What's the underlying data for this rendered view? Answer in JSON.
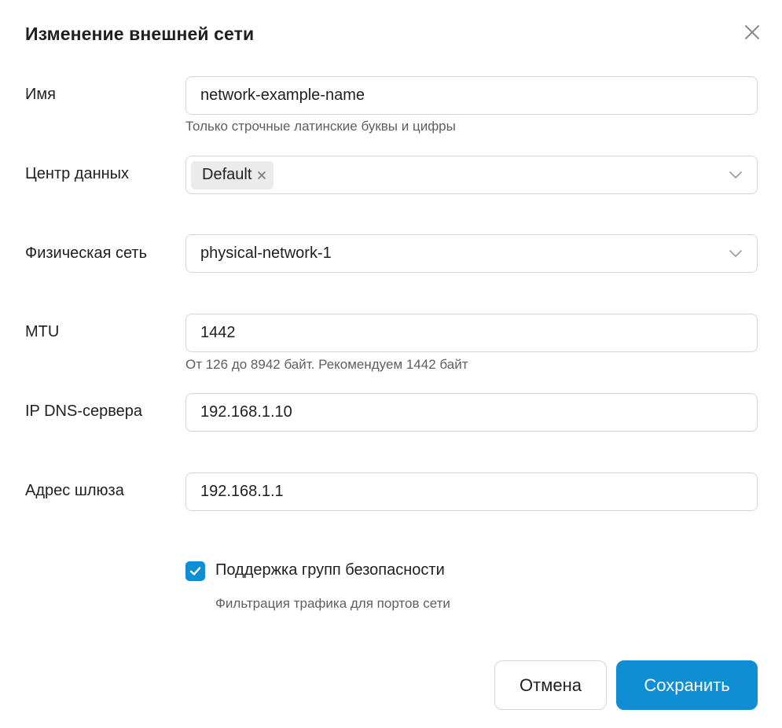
{
  "dialog": {
    "title": "Изменение внешней сети",
    "close_icon": "close-icon"
  },
  "form": {
    "name": {
      "label": "Имя",
      "value": "network-example-name",
      "hint": "Только строчные латинские буквы и цифры"
    },
    "datacenter": {
      "label": "Центр данных",
      "selected_tags": [
        "Default"
      ],
      "icon": "chevron-down-icon"
    },
    "physical_network": {
      "label": "Физическая сеть",
      "value": "physical-network-1",
      "icon": "chevron-down-icon"
    },
    "mtu": {
      "label": "MTU",
      "value": "1442",
      "hint": "От 126 до 8942 байт. Рекомендуем 1442 байт"
    },
    "dns": {
      "label": "IP DNS-сервера",
      "value": "192.168.1.10"
    },
    "gateway": {
      "label": "Адрес шлюза",
      "value": "192.168.1.1"
    },
    "security_groups": {
      "label": "Поддержка групп безопасности",
      "hint": "Фильтрация трафика для портов сети",
      "checked": true
    }
  },
  "actions": {
    "cancel_label": "Отмена",
    "save_label": "Сохранить"
  },
  "colors": {
    "accent": "#0f8ed6",
    "border": "#d6d6d6",
    "hint_text": "#5f5f5f",
    "tag_bg": "#ebebeb"
  }
}
